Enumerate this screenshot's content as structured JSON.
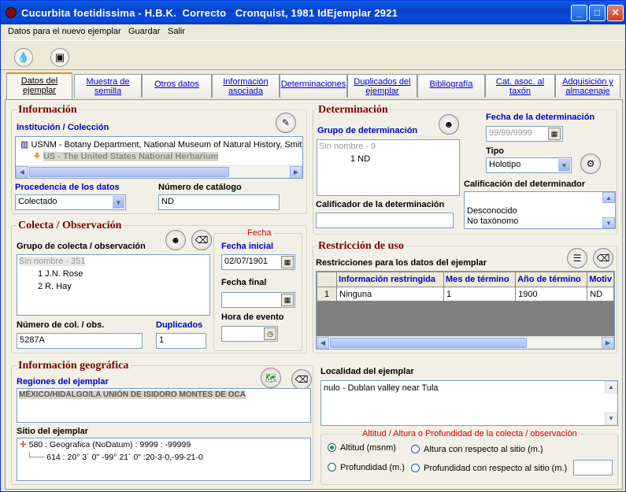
{
  "window": {
    "title": "Cucurbita foetidissima - H.B.K.  Correcto   Cronquist, 1981 IdEjemplar 2921"
  },
  "menu": [
    "Datos para el nuevo ejemplar",
    "Guardar",
    "Salir"
  ],
  "tabs": [
    {
      "label": "Datos del ejemplar",
      "active": true
    },
    {
      "label": "Muestra de semilla"
    },
    {
      "label": "Otros datos"
    },
    {
      "label": "Información asociada"
    },
    {
      "label": "Determinaciones"
    },
    {
      "label": "Duplicados del ejemplar"
    },
    {
      "label": "Bibliografía"
    },
    {
      "label": "Cat. asoc. al taxón"
    },
    {
      "label": "Adquisición y almacenaje"
    }
  ],
  "informacion": {
    "legend": "Información",
    "inst_label": "Institución / Colección",
    "inst_item": "USNM - Botany Department, National Museum of Natural History, Smit",
    "coll_item": "US - The United States National Herbarium",
    "proc_label": "Procedencia de los datos",
    "proc_value": "Colectado",
    "cat_label": "Número de catálogo",
    "cat_value": "ND"
  },
  "determinacion": {
    "legend": "Determinación",
    "grupo_label": "Grupo de determinación",
    "grupo_header": "Sin nombre - 9",
    "grupo_item": "1 ND",
    "fecha_label": "Fecha de la determinación",
    "fecha_value": "99/99/9999",
    "tipo_label": "Tipo",
    "tipo_value": "Holotipo",
    "calif_det_label": "Calificador de la determinación",
    "calif_deter_label": "Calificación del determinador",
    "calif_items": [
      "Desconocido",
      "No taxónomo"
    ]
  },
  "colecta": {
    "legend": "Colecta / Observación",
    "grupo_label": "Grupo de colecta / observación",
    "grupo_header": "Sin nombre - 351",
    "colectores": [
      "1 J.N. Rose",
      "2 R. Hay"
    ],
    "num_label": "Número de col. / obs.",
    "num_value": "5287A",
    "dup_label": "Duplicados",
    "dup_value": "1",
    "fecha_legend": "Fecha",
    "fecha_ini_label": "Fecha inicial",
    "fecha_ini_value": "02/07/1901",
    "fecha_fin_label": "Fecha final",
    "fecha_fin_value": "",
    "hora_label": "Hora de evento"
  },
  "restriccion": {
    "legend": "Restricción de uso",
    "sub_label": "Restricciones para los datos del ejemplar",
    "columns": [
      "Información restringida",
      "Mes de término",
      "Año de término",
      "Motiv"
    ],
    "rows": [
      {
        "n": "1",
        "info": "Ninguna",
        "mes": "1",
        "anio": "1900",
        "motivo": "ND"
      }
    ]
  },
  "geografica": {
    "legend": "Información geográfica",
    "regiones_label": "Regiones del ejemplar",
    "region_value": "MÉXICO/HIDALGO/LA UNIÓN DE ISIDORO MONTES DE OCA",
    "sitio_label": "Sitio del ejemplar",
    "sitio_items": [
      "580 : Geografica (NoDatum) : 9999 : -99999",
      "614 : 20° 3´ 0\" -99° 21´ 0\" :20-3-0,-99-21-0"
    ]
  },
  "localidad": {
    "label": "Localidad del ejemplar",
    "value": "nulo - Dublan valley near Tula"
  },
  "altitud": {
    "legend": "Altitud / Altura o Profundidad de la colecta / observación",
    "options": [
      "Altitud (msnm)",
      "Altura con respecto al sitio (m.)",
      "Profundidad (m.)",
      "Profundidad con respecto al sitio (m.)"
    ],
    "selected": "Altitud (msnm)"
  }
}
